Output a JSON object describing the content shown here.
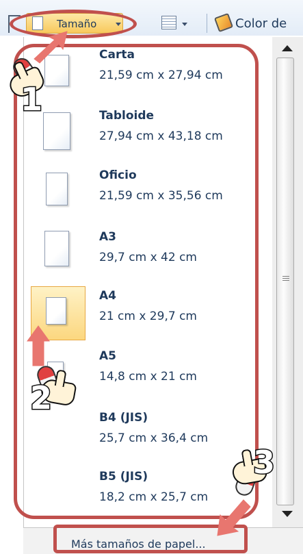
{
  "toolbar": {
    "size_label": "Tamaño",
    "color_label": "Color de"
  },
  "paper_sizes": [
    {
      "name": "Carta",
      "dims": "21,59 cm x 27,94 cm"
    },
    {
      "name": "Tabloide",
      "dims": "27,94 cm x 43,18 cm"
    },
    {
      "name": "Oficio",
      "dims": "21,59 cm x 35,56 cm"
    },
    {
      "name": "A3",
      "dims": "29,7 cm x 42 cm"
    },
    {
      "name": "A4",
      "dims": "21 cm x 29,7 cm",
      "selected": true
    },
    {
      "name": "A5",
      "dims": "14,8 cm x 21 cm"
    },
    {
      "name": "B4 (JIS)",
      "dims": "25,7 cm x 36,4 cm"
    },
    {
      "name": "B5 (JIS)",
      "dims": "18,2 cm x 25,7 cm"
    }
  ],
  "footer": {
    "more_sizes": "Más tamaños de papel..."
  },
  "annotations": {
    "step1": "1",
    "step2": "2",
    "step3": "3",
    "color": "#c0504d"
  },
  "icons": [
    "ruler-icon",
    "page-icon",
    "columns-icon",
    "page-color-icon",
    "scroll-up-icon",
    "scroll-down-icon"
  ]
}
